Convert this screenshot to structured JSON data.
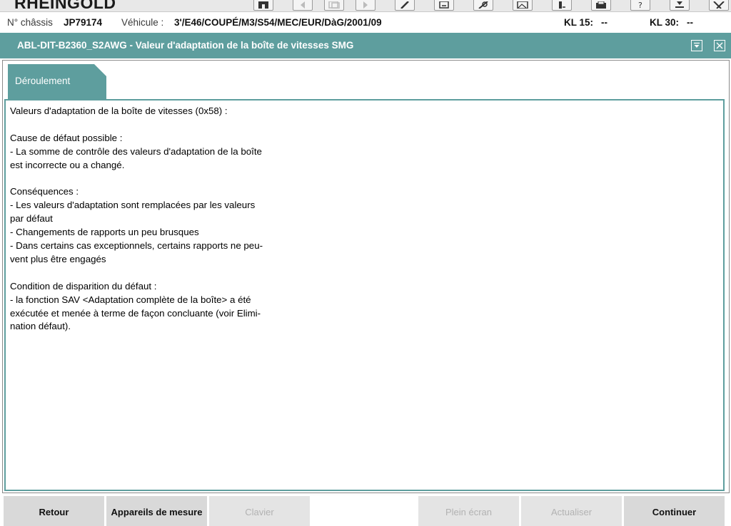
{
  "app": {
    "title": "RHEINGOLD"
  },
  "toolbar": {
    "icons": [
      "home-icon",
      "back-arrow-icon",
      "copy-icon",
      "forward-arrow-icon",
      "wrench-icon",
      "exchange-icon",
      "measurement-icon",
      "image-icon",
      "vehicle-icon",
      "print-icon",
      "help-icon",
      "download-icon",
      "close-icon"
    ]
  },
  "vehicle": {
    "chassis_label": "N° châssis",
    "chassis_value": "JP79174",
    "vehicle_label": "Véhicule :",
    "vehicle_value": "3'/E46/COUPÉ/M3/S54/MEC/EUR/DàG/2001/09",
    "kl15_label": "KL 15:",
    "kl15_value": "--",
    "kl30_label": "KL 30:",
    "kl30_value": "--"
  },
  "window": {
    "title": "ABL-DIT-B2360_S2AWG  -  Valeur d'adaptation de la boîte de vitesses SMG"
  },
  "tab": {
    "label": "Déroulement"
  },
  "content": {
    "lines": [
      "Valeurs d'adaptation de la boîte de vitesses (0x58) :",
      "",
      "Cause de défaut possible :",
      "- La somme de contrôle des valeurs d'adaptation de la boîte",
      "est incorrecte ou a changé.",
      "",
      "Conséquences :",
      "- Les valeurs d'adaptation sont remplacées par les valeurs",
      "par défaut",
      "- Changements de rapports un peu brusques",
      "- Dans certains cas exceptionnels, certains rapports ne peu-",
      "vent plus être engagés",
      "",
      "Condition de disparition du défaut :",
      "-  la fonction SAV <Adaptation complète de la boîte> a été",
      "exécutée et menée à terme de façon concluante (voir Elimi-",
      "nation défaut)."
    ]
  },
  "buttons": {
    "back": "Retour",
    "measuring": "Appareils de mesure",
    "keyboard": "Clavier",
    "fullscreen": "Plein écran",
    "refresh": "Actualiser",
    "continue": "Continuer"
  },
  "colors": {
    "accent": "#5e9e9e",
    "button": "#d9d9d9",
    "button_disabled_text": "#b2b2b2"
  }
}
